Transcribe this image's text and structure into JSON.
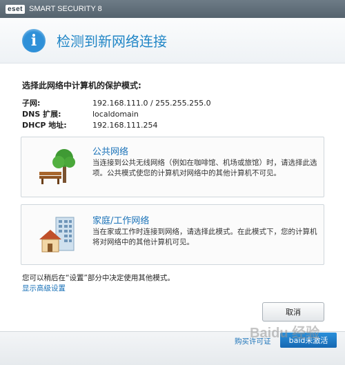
{
  "titlebar": {
    "logo": "eset",
    "title": "SMART SECURITY 8"
  },
  "header": {
    "icon": "info-icon",
    "title": "检测到新网络连接"
  },
  "network": {
    "heading": "选择此网络中计算机的保护模式:",
    "fields": [
      {
        "label": "子网:",
        "value": "192.168.111.0 / 255.255.255.0"
      },
      {
        "label": "DNS 扩展:",
        "value": "localdomain"
      },
      {
        "label": "DHCP 地址:",
        "value": "192.168.111.254"
      }
    ]
  },
  "options": [
    {
      "title": "公共网络",
      "description": "当连接到公共无线网络（例如在咖啡馆、机场或旅馆）时，请选择此选项。公共模式使您的计算机对网络中的其他计算机不可见。",
      "icon": "park-bench-tree-icon"
    },
    {
      "title": "家庭/工作网络",
      "description": "当在家或工作时连接到网络，请选择此模式。在此模式下，您的计算机将对网络中的其他计算机可见。",
      "icon": "house-building-icon"
    }
  ],
  "note": "您可以稍后在“设置”部分中决定使用其他模式。",
  "advanced_link": "显示高级设置",
  "cancel_label": "取消",
  "footer": {
    "buy_label": "购买许可证",
    "activate_label": "baid未激活"
  },
  "watermark": "Baidu 经验",
  "colors": {
    "accent": "#2186c6",
    "link": "#1a72b8"
  }
}
